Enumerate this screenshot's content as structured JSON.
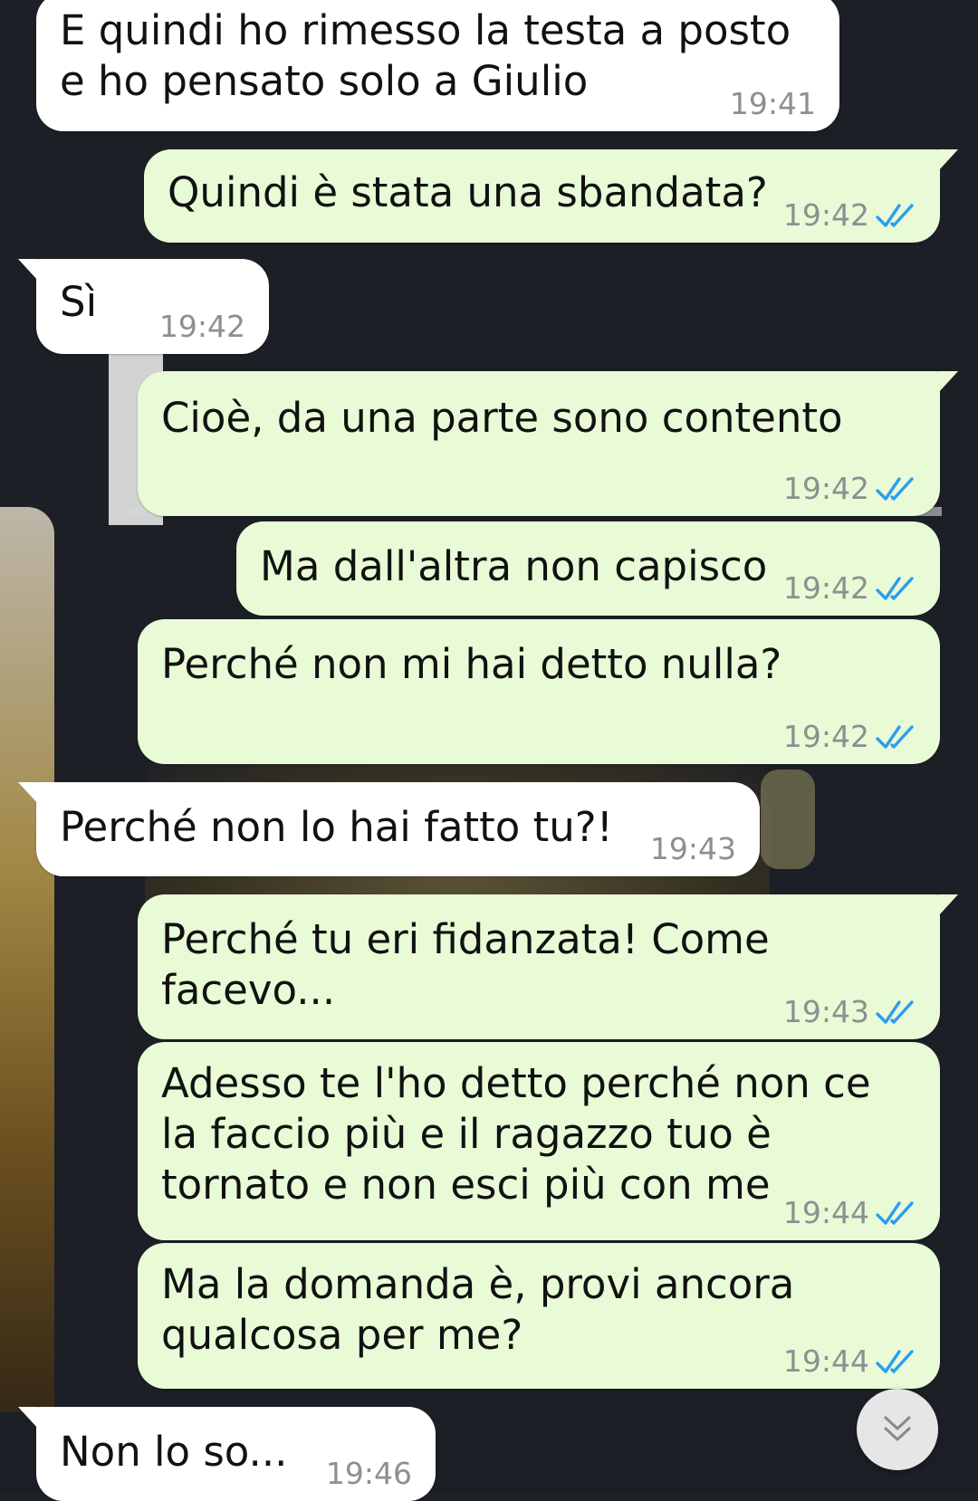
{
  "chat": {
    "messages": [
      {
        "direction": "incoming",
        "text": "E quindi ho rimesso la testa a posto e ho pensato solo a Giulio",
        "time": "19:41"
      },
      {
        "direction": "outgoing",
        "text": "Quindi è stata una sbandata?",
        "time": "19:42",
        "status": "read"
      },
      {
        "direction": "incoming",
        "text": "Sì",
        "time": "19:42"
      },
      {
        "direction": "outgoing",
        "text": "Cioè, da una parte sono contento",
        "time": "19:42",
        "status": "read"
      },
      {
        "direction": "outgoing",
        "text": "Ma dall'altra non capisco",
        "time": "19:42",
        "status": "read"
      },
      {
        "direction": "outgoing",
        "text": "Perché non mi hai detto nulla?",
        "time": "19:42",
        "status": "read"
      },
      {
        "direction": "incoming",
        "text": "Perché non lo hai fatto tu?!",
        "time": "19:43"
      },
      {
        "direction": "outgoing",
        "text": "Perché tu eri fidanzata! Come facevo...",
        "time": "19:43",
        "status": "read"
      },
      {
        "direction": "outgoing",
        "text": "Adesso te l'ho detto perché non ce la faccio più e il ragazzo tuo è tornato e non esci più con me",
        "time": "19:44",
        "status": "read"
      },
      {
        "direction": "outgoing",
        "text": "Ma la domanda è, provi ancora qualcosa per me?",
        "time": "19:44",
        "status": "read"
      },
      {
        "direction": "incoming",
        "text": "Non lo so...",
        "time": "19:46"
      }
    ]
  },
  "icons": {
    "read_receipt": "double-check-icon",
    "scroll_down": "double-chevron-down-icon"
  },
  "colors": {
    "incoming_bubble": "#ffffff",
    "outgoing_bubble": "#e8fbd6",
    "timestamp": "#8d8f91",
    "read_ticks": "#2d9cf0",
    "wallpaper": "#1c1f26"
  }
}
